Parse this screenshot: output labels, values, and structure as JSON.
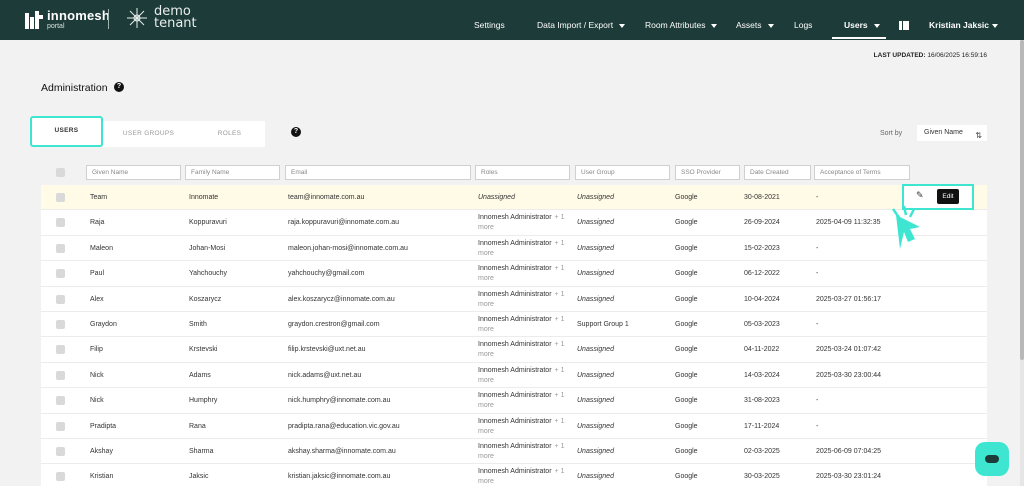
{
  "header": {
    "logo_name": "innomesh",
    "logo_sub": "portal",
    "tenant_line1": "demo",
    "tenant_line2": "tenant",
    "nav": {
      "settings": "Settings",
      "data_import_export": "Data Import / Export",
      "room_attributes": "Room Attributes",
      "assets": "Assets",
      "logs": "Logs",
      "users": "Users",
      "user_name": "Kristian Jaksic"
    }
  },
  "last_updated": {
    "label": "LAST UPDATED:",
    "value": "16/06/2025 16:59:16"
  },
  "page": {
    "title": "Administration"
  },
  "tabs": [
    {
      "label": "USERS"
    },
    {
      "label": "USER GROUPS"
    },
    {
      "label": "ROLES"
    }
  ],
  "sort": {
    "label": "Sort by",
    "value": "Given Name"
  },
  "filters": {
    "given_name": "Given Name",
    "family_name": "Family Name",
    "email": "Email",
    "roles": "Roles",
    "user_group": "User Group",
    "sso_provider": "SSO Provider",
    "date_created": "Date Created",
    "acceptance": "Acceptance of Terms"
  },
  "rows": [
    {
      "given": "Team",
      "family": "Innomate",
      "email": "team@innomate.com.au",
      "role": "Unassigned",
      "more": "",
      "group": "Unassigned",
      "sso": "Google",
      "created": "30-08-2021",
      "accepted": "-"
    },
    {
      "given": "Raja",
      "family": "Koppuravuri",
      "email": "raja.koppuravuri@innomate.com.au",
      "role": "Innomesh Administrator",
      "more": "+ 1",
      "group": "Unassigned",
      "sso": "Google",
      "created": "26-09-2024",
      "accepted": "2025-04-09 11:32:35"
    },
    {
      "given": "Maleon",
      "family": "Johan-Mosi",
      "email": "maleon.johan-mosi@innomate.com.au",
      "role": "Innomesh Administrator",
      "more": "+ 1",
      "group": "Unassigned",
      "sso": "Google",
      "created": "15-02-2023",
      "accepted": "-"
    },
    {
      "given": "Paul",
      "family": "Yahchouchy",
      "email": "yahchouchy@gmail.com",
      "role": "Innomesh Administrator",
      "more": "+ 1",
      "group": "Unassigned",
      "sso": "Google",
      "created": "06-12-2022",
      "accepted": "-"
    },
    {
      "given": "Alex",
      "family": "Koszarycz",
      "email": "alex.koszarycz@innomate.com.au",
      "role": "Innomesh Administrator",
      "more": "+ 1",
      "group": "Unassigned",
      "sso": "Google",
      "created": "10-04-2024",
      "accepted": "2025-03-27 01:56:17"
    },
    {
      "given": "Graydon",
      "family": "Smith",
      "email": "graydon.crestron@gmail.com",
      "role": "Innomesh Administrator",
      "more": "+ 1",
      "group": "Support Group 1",
      "sso": "Google",
      "created": "05-03-2023",
      "accepted": "-"
    },
    {
      "given": "Filip",
      "family": "Krstevski",
      "email": "filip.krstevski@uxt.net.au",
      "role": "Innomesh Administrator",
      "more": "+ 1",
      "group": "Unassigned",
      "sso": "Google",
      "created": "04-11-2022",
      "accepted": "2025-03-24 01:07:42"
    },
    {
      "given": "Nick",
      "family": "Adams",
      "email": "nick.adams@uxt.net.au",
      "role": "Innomesh Administrator",
      "more": "+ 1",
      "group": "Unassigned",
      "sso": "Google",
      "created": "14-03-2024",
      "accepted": "2025-03-30 23:00:44"
    },
    {
      "given": "Nick",
      "family": "Humphry",
      "email": "nick.humphry@innomate.com.au",
      "role": "Innomesh Administrator",
      "more": "+ 1",
      "group": "Unassigned",
      "sso": "Google",
      "created": "31-08-2023",
      "accepted": "-"
    },
    {
      "given": "Pradipta",
      "family": "Rana",
      "email": "pradipta.rana@education.vic.gov.au",
      "role": "Innomesh Administrator",
      "more": "+ 1",
      "group": "Unassigned",
      "sso": "Google",
      "created": "17-11-2024",
      "accepted": "-"
    },
    {
      "given": "Akshay",
      "family": "Sharma",
      "email": "akshay.sharma@innomate.com.au",
      "role": "Innomesh Administrator",
      "more": "+ 1",
      "group": "Unassigned",
      "sso": "Google",
      "created": "02-03-2025",
      "accepted": "2025-06-09 07:04:25"
    },
    {
      "given": "Kristian",
      "family": "Jaksic",
      "email": "kristian.jaksic@innomate.com.au",
      "role": "Innomesh Administrator",
      "more": "+ 1",
      "group": "Unassigned",
      "sso": "Google",
      "created": "30-03-2025",
      "accepted": "2025-03-30 23:01:24"
    }
  ],
  "more_label": "more",
  "actions": {
    "edit_label": "Edit",
    "pencil_icon": "pencil-icon"
  },
  "colors": {
    "header_bg": "#1d3b38",
    "accent": "#3ee6d1",
    "highlight_row": "#fffbe6"
  }
}
